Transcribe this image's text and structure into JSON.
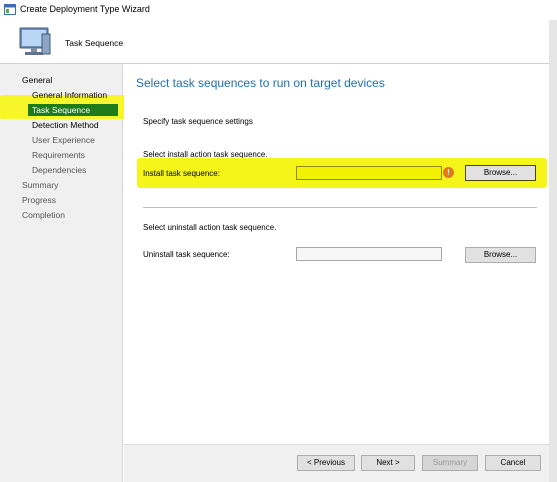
{
  "window": {
    "title": "Create Deployment Type Wizard"
  },
  "header": {
    "title": "Task Sequence"
  },
  "nav": {
    "items": [
      {
        "label": "General",
        "state": "normal",
        "level": 0
      },
      {
        "label": "General Information",
        "state": "normal",
        "level": 1
      },
      {
        "label": "Task Sequence",
        "state": "active",
        "level": 1
      },
      {
        "label": "Detection Method",
        "state": "normal",
        "level": 1
      },
      {
        "label": "User Experience",
        "state": "disabled",
        "level": 1
      },
      {
        "label": "Requirements",
        "state": "disabled",
        "level": 1
      },
      {
        "label": "Dependencies",
        "state": "disabled",
        "level": 1
      },
      {
        "label": "Summary",
        "state": "disabled",
        "level": 0
      },
      {
        "label": "Progress",
        "state": "disabled",
        "level": 0
      },
      {
        "label": "Completion",
        "state": "disabled",
        "level": 0
      }
    ]
  },
  "main": {
    "title": "Select task sequences to run on target devices",
    "settings_heading": "Specify task sequence settings",
    "install": {
      "section_label": "Select install action task sequence.",
      "field_label": "Install task sequence:",
      "value": "",
      "browse_label": "Browse..."
    },
    "uninstall": {
      "section_label": "Select uninstall action task sequence.",
      "field_label": "Uninstall task sequence:",
      "value": "",
      "browse_label": "Browse..."
    }
  },
  "footer": {
    "previous_label": "< Previous",
    "next_label": "Next >",
    "summary_label": "Summary",
    "cancel_label": "Cancel"
  },
  "colors": {
    "accent_title": "#1e6fb5",
    "active_nav": "#1e7b1a",
    "highlight": "#f4f400",
    "error_icon": "#e2761b"
  },
  "icons": {
    "title_icon": "wizard-window-icon",
    "header_icon": "computer-monitor-icon",
    "error_icon": "error-icon"
  }
}
